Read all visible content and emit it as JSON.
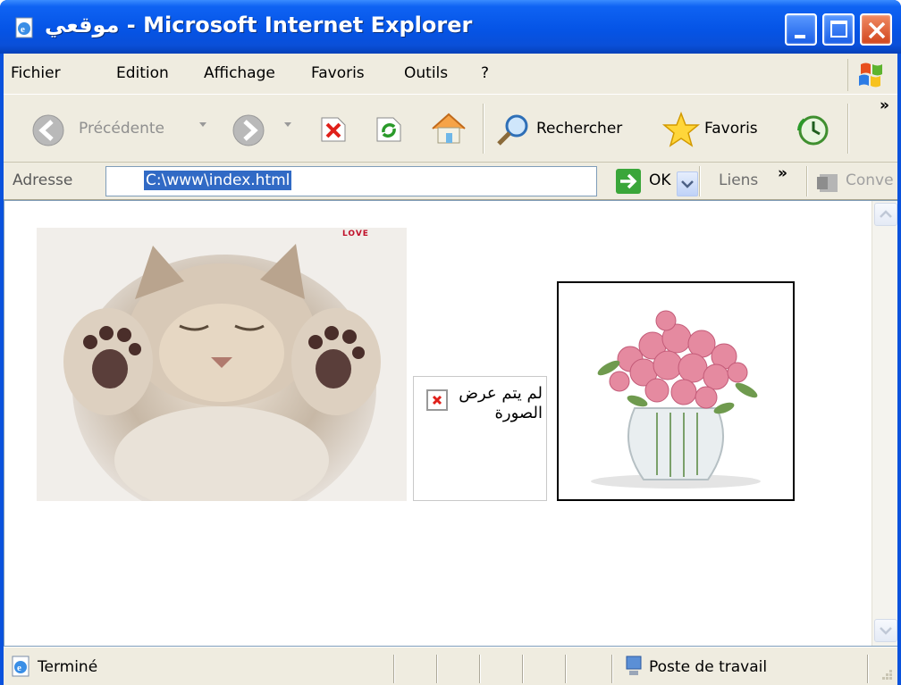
{
  "window": {
    "title": "موقعي - Microsoft Internet Explorer"
  },
  "menu": {
    "items": [
      "Fichier",
      "Edition",
      "Affichage",
      "Favoris",
      "Outils",
      "?"
    ]
  },
  "toolbar": {
    "back_label": "Précédente",
    "search_label": "Rechercher",
    "favorites_label": "Favoris",
    "overflow": "»"
  },
  "address_bar": {
    "label": "Adresse",
    "value": "C:\\www\\index.html",
    "go_label": "OK",
    "links_label": "Liens",
    "links_overflow": "»",
    "convert_label": "Conve"
  },
  "page": {
    "banner_text": "LOVE",
    "broken_image_alt": "لم يتم عرض الصورة"
  },
  "status": {
    "text": "Terminé",
    "zone": "Poste de travail"
  },
  "colors": {
    "titlebar": "#0554e6",
    "chrome": "#efece0",
    "selection": "#316ac5",
    "close": "#d2461d"
  }
}
